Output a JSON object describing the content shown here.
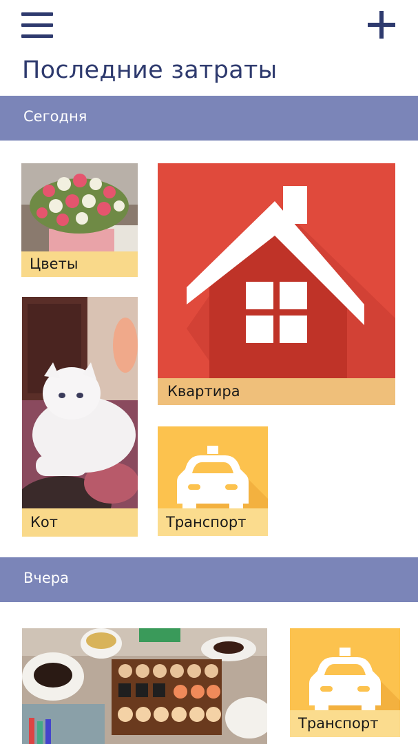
{
  "header": {
    "title": "Последние затраты"
  },
  "sections": [
    {
      "label": "Сегодня",
      "tiles": [
        {
          "label": "Цветы",
          "icon": "flowers-photo"
        },
        {
          "label": "Кот",
          "icon": "cat-photo"
        },
        {
          "label": "Квартира",
          "icon": "house-icon"
        },
        {
          "label": "Транспорт",
          "icon": "taxi-icon"
        }
      ]
    },
    {
      "label": "Вчера",
      "tiles": [
        {
          "label": "",
          "icon": "sushi-photo"
        },
        {
          "label": "Транспорт",
          "icon": "taxi-icon"
        }
      ]
    }
  ],
  "colors": {
    "accent": "#2e3a6e",
    "section_bar": "#7b85b8",
    "caption_bg": "#f9d98a",
    "house_tile": "#e04a3c",
    "taxi_tile": "#fcc24e"
  }
}
